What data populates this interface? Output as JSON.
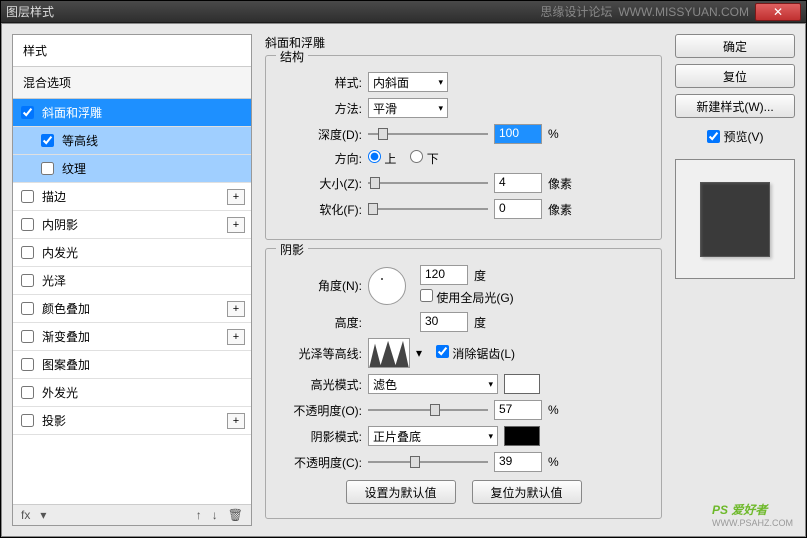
{
  "titlebar": {
    "title": "图层样式",
    "forum": "思缘设计论坛",
    "url": "WWW.MISSYUAN.COM"
  },
  "left": {
    "styles_header": "样式",
    "blend_header": "混合选项",
    "items": [
      {
        "label": "斜面和浮雕",
        "checked": true
      },
      {
        "label": "等高线",
        "checked": true
      },
      {
        "label": "纹理",
        "checked": false
      },
      {
        "label": "描边",
        "checked": false
      },
      {
        "label": "内阴影",
        "checked": false
      },
      {
        "label": "内发光",
        "checked": false
      },
      {
        "label": "光泽",
        "checked": false
      },
      {
        "label": "颜色叠加",
        "checked": false
      },
      {
        "label": "渐变叠加",
        "checked": false
      },
      {
        "label": "图案叠加",
        "checked": false
      },
      {
        "label": "外发光",
        "checked": false
      },
      {
        "label": "投影",
        "checked": false
      }
    ],
    "fx": "fx"
  },
  "center": {
    "title": "斜面和浮雕",
    "structure": {
      "legend": "结构",
      "style_label": "样式:",
      "style_value": "内斜面",
      "method_label": "方法:",
      "method_value": "平滑",
      "depth_label": "深度(D):",
      "depth_value": "100",
      "pct": "%",
      "direction_label": "方向:",
      "up": "上",
      "down": "下",
      "size_label": "大小(Z):",
      "size_value": "4",
      "px": "像素",
      "soften_label": "软化(F):",
      "soften_value": "0"
    },
    "shadow": {
      "legend": "阴影",
      "angle_label": "角度(N):",
      "angle_value": "120",
      "deg": "度",
      "global_label": "使用全局光(G)",
      "altitude_label": "高度:",
      "altitude_value": "30",
      "contour_label": "光泽等高线:",
      "antialias_label": "消除锯齿(L)",
      "hilite_mode_label": "高光模式:",
      "hilite_mode_value": "滤色",
      "opacity_label": "不透明度(O):",
      "opacity_value": "57",
      "shadow_mode_label": "阴影模式:",
      "shadow_mode_value": "正片叠底",
      "opacity2_label": "不透明度(C):",
      "opacity2_value": "39",
      "pct": "%"
    },
    "defaults_set": "设置为默认值",
    "defaults_reset": "复位为默认值"
  },
  "right": {
    "ok": "确定",
    "cancel": "复位",
    "new_style": "新建样式(W)...",
    "preview": "预览(V)"
  },
  "watermark": {
    "brand": "PS 爱好者",
    "url": "WWW.PSAHZ.COM"
  }
}
